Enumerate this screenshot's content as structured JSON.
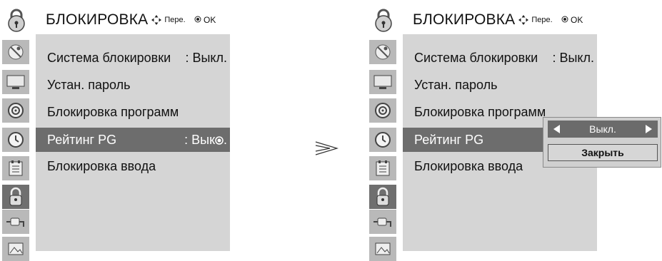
{
  "menu": {
    "title": "БЛОКИРОВКА",
    "hint_move": "Пере.",
    "hint_ok": "OK",
    "items": [
      {
        "label": "Система блокировки",
        "value": ": Выкл."
      },
      {
        "label": "Устан. пароль",
        "value": ""
      },
      {
        "label": "Блокировка программ",
        "value": ""
      },
      {
        "label": "Рейтинг PG",
        "value": ": Вык"
      },
      {
        "label": "Блокировка ввода",
        "value": ""
      }
    ]
  },
  "popup": {
    "value": "Выкл.",
    "close_label": "Закрыть"
  },
  "sidebar_icons": [
    "lock-icon",
    "satellite-icon",
    "screen-icon",
    "speaker-icon",
    "clock-icon",
    "calendar-icon",
    "lock-icon",
    "plug-icon",
    "photo-icon"
  ],
  "colors": {
    "selected_bg": "#6d6d6d",
    "content_bg": "#d5d5d5",
    "sidebar_item": "#b9b9b9"
  }
}
